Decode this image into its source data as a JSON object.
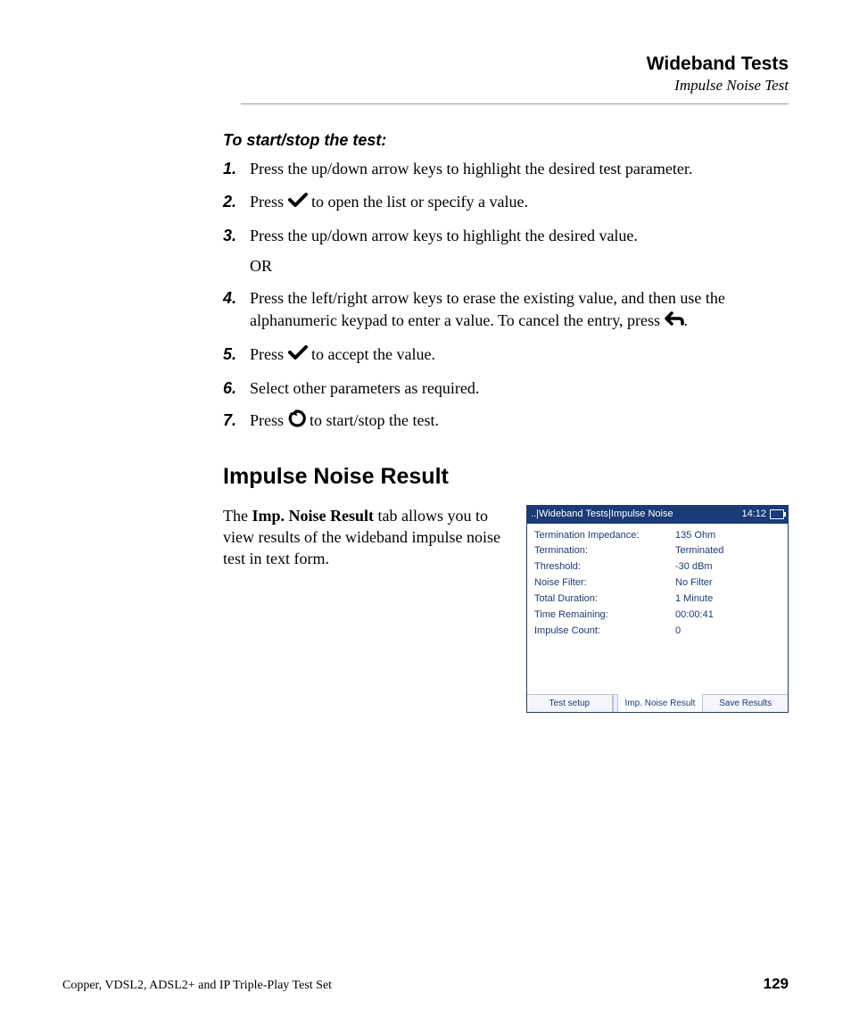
{
  "header": {
    "title": "Wideband Tests",
    "subtitle": "Impulse Noise Test"
  },
  "instructions": {
    "title": "To start/stop the test:",
    "steps": [
      {
        "num": "1.",
        "pre": "Press the up/down arrow keys to highlight the desired test parameter.",
        "icon": null,
        "post": ""
      },
      {
        "num": "2.",
        "pre": "Press ",
        "icon": "check",
        "post": " to open the list or specify a value."
      },
      {
        "num": "3.",
        "pre": "Press the up/down arrow keys to highlight the desired value.",
        "icon": null,
        "post": "",
        "extra": "OR"
      },
      {
        "num": "4.",
        "pre": "Press the left/right arrow keys to erase the existing value, and then use the alphanumeric keypad to enter a value. To cancel the entry, press ",
        "icon": "back",
        "post": "."
      },
      {
        "num": "5.",
        "pre": "Press ",
        "icon": "check",
        "post": " to accept the value."
      },
      {
        "num": "6.",
        "pre": "Select other parameters as required.",
        "icon": null,
        "post": ""
      },
      {
        "num": "7.",
        "pre": "Press ",
        "icon": "cycle",
        "post": " to start/stop the test."
      }
    ]
  },
  "section": {
    "heading": "Impulse Noise Result",
    "para_pre": "The ",
    "para_bold": "Imp. Noise Result",
    "para_post": " tab allows you to view results of the wideband impulse noise test in text form."
  },
  "device": {
    "breadcrumb": "..|Wideband Tests|Impulse Noise",
    "time": "14:12",
    "rows": [
      {
        "label": "Termination Impedance:",
        "value": "135 Ohm"
      },
      {
        "label": "Termination:",
        "value": "Terminated"
      },
      {
        "label": "Threshold:",
        "value": "-30 dBm"
      },
      {
        "label": "Noise Filter:",
        "value": "No Filter"
      },
      {
        "label": "Total Duration:",
        "value": "1 Minute"
      },
      {
        "label": "Time Remaining:",
        "value": "00:00:41"
      },
      {
        "label": "Impulse Count:",
        "value": "0"
      }
    ],
    "tabs": [
      {
        "label": "Test setup",
        "active": false
      },
      {
        "label": "Imp. Noise Result",
        "active": true
      },
      {
        "label": "Save Results",
        "active": false
      }
    ]
  },
  "footer": {
    "left": "Copper, VDSL2, ADSL2+ and IP Triple-Play Test Set",
    "page": "129"
  },
  "icons": {
    "check": "check-icon",
    "back": "back-arrow-icon",
    "cycle": "cycle-arrow-icon"
  }
}
